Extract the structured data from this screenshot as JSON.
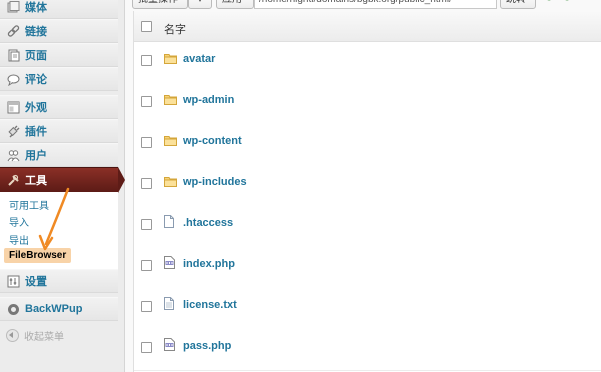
{
  "sidebar": {
    "items": [
      {
        "id": "media",
        "label": "媒体",
        "icon": "media-icon"
      },
      {
        "id": "links",
        "label": "链接",
        "icon": "link-icon"
      },
      {
        "id": "pages",
        "label": "页面",
        "icon": "page-icon"
      },
      {
        "id": "comments",
        "label": "评论",
        "icon": "comment-icon"
      },
      {
        "id": "appearance",
        "label": "外观",
        "icon": "appearance-icon"
      },
      {
        "id": "plugins",
        "label": "插件",
        "icon": "plugin-icon"
      },
      {
        "id": "users",
        "label": "用户",
        "icon": "users-icon"
      },
      {
        "id": "tools",
        "label": "工具",
        "icon": "tools-icon",
        "active": true
      },
      {
        "id": "settings",
        "label": "设置",
        "icon": "settings-icon"
      },
      {
        "id": "backwpup",
        "label": "BackWPup",
        "icon": "backwpup-icon"
      }
    ],
    "submenu": [
      {
        "label": "可用工具"
      },
      {
        "label": "导入"
      },
      {
        "label": "导出"
      },
      {
        "label": "FileBrowser",
        "current": true
      }
    ],
    "collapse_label": "收起菜单",
    "active_color": "#6e2219",
    "link_color": "#21759b",
    "highlight_color": "#f8d3a8"
  },
  "topbar": {
    "select_label": "批量操作",
    "apply_label": "应用",
    "path_value": "/home/nightl/domains/bgbk.org/public_html/",
    "go_label": "跳转"
  },
  "filelist": {
    "header": "名字",
    "files": [
      {
        "name": "avatar",
        "type": "folder"
      },
      {
        "name": "wp-admin",
        "type": "folder"
      },
      {
        "name": "wp-content",
        "type": "folder"
      },
      {
        "name": "wp-includes",
        "type": "folder"
      },
      {
        "name": ".htaccess",
        "type": "file"
      },
      {
        "name": "index.php",
        "type": "php"
      },
      {
        "name": "license.txt",
        "type": "file"
      },
      {
        "name": "pass.php",
        "type": "php"
      }
    ]
  },
  "annotation_color": "#f08a24"
}
